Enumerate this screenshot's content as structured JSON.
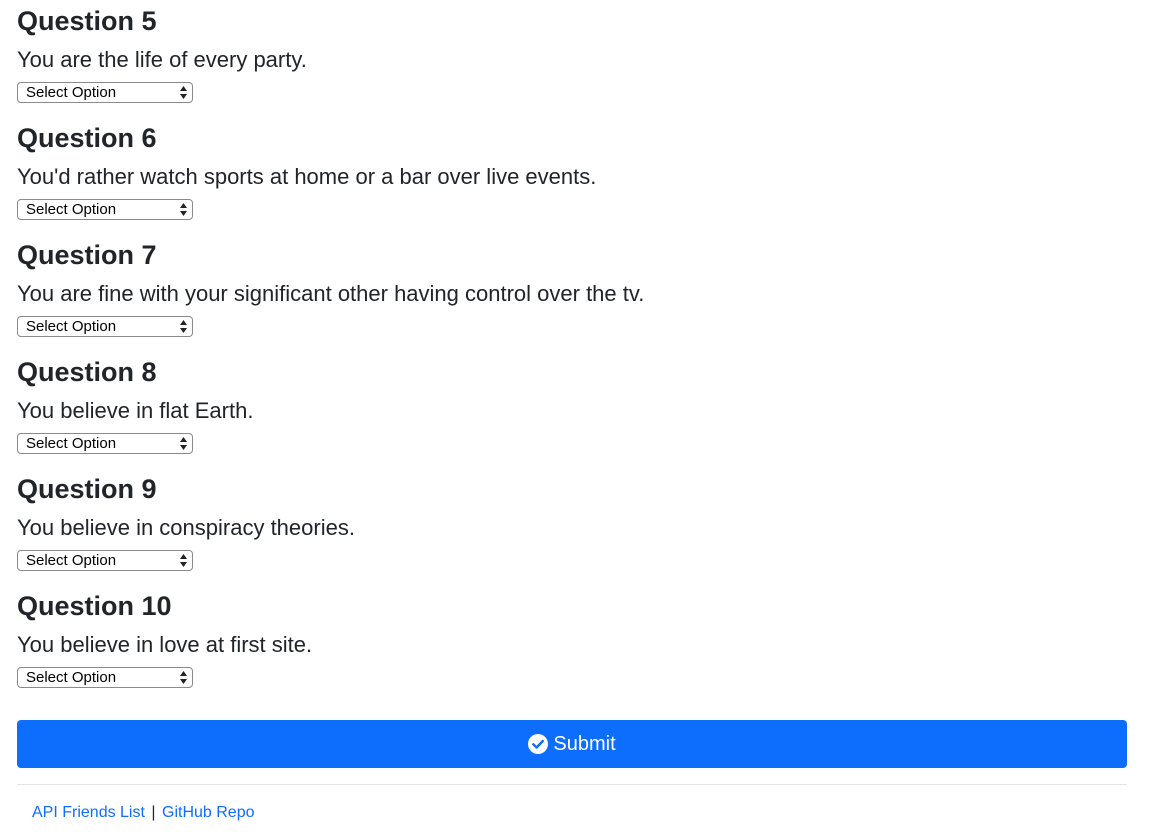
{
  "questions": [
    {
      "title": "Question 5",
      "text": "You are the life of every party.",
      "select_value": "Select Option"
    },
    {
      "title": "Question 6",
      "text": "You'd rather watch sports at home or a bar over live events.",
      "select_value": "Select Option"
    },
    {
      "title": "Question 7",
      "text": "You are fine with your significant other having control over the tv.",
      "select_value": "Select Option"
    },
    {
      "title": "Question 8",
      "text": "You believe in flat Earth.",
      "select_value": "Select Option"
    },
    {
      "title": "Question 9",
      "text": "You believe in conspiracy theories.",
      "select_value": "Select Option"
    },
    {
      "title": "Question 10",
      "text": "You believe in love at first site.",
      "select_value": "Select Option"
    }
  ],
  "submit": {
    "label": "Submit",
    "icon": "check-circle-icon"
  },
  "footer": {
    "link1": "API Friends List",
    "separator": "|",
    "link2": "GitHub Repo"
  },
  "colors": {
    "primary": "#0d6efd",
    "text": "#212529",
    "divider": "#e3e3e3"
  }
}
